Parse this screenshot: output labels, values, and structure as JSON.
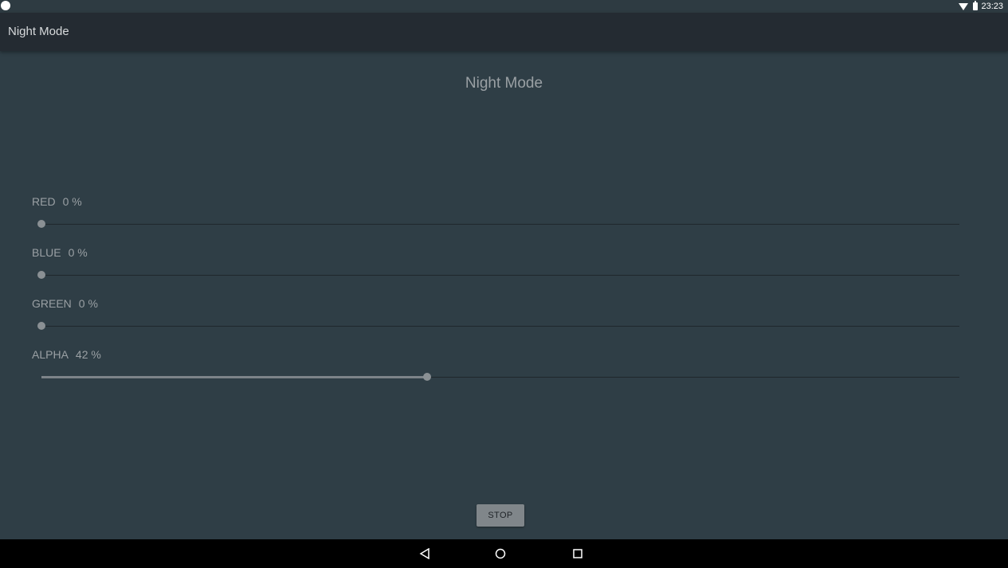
{
  "status_bar": {
    "time": "23:23",
    "icons": [
      "wifi-icon",
      "battery-icon"
    ]
  },
  "app_bar": {
    "title": "Night Mode"
  },
  "page": {
    "title": "Night Mode"
  },
  "sliders": [
    {
      "label": "RED",
      "value_text": "0 %",
      "value_fraction": 0.0
    },
    {
      "label": "BLUE",
      "value_text": "0 %",
      "value_fraction": 0.0
    },
    {
      "label": "GREEN",
      "value_text": "0 %",
      "value_fraction": 0.0
    },
    {
      "label": "ALPHA",
      "value_text": "42 %",
      "value_fraction": 0.42
    }
  ],
  "stop_button": {
    "label": "STOP"
  },
  "nav_bar": {
    "buttons": [
      "back-icon",
      "home-icon",
      "recents-icon"
    ]
  },
  "colors": {
    "background": "#2f3e46",
    "app_bar": "#242b32",
    "button": "#80868a"
  }
}
